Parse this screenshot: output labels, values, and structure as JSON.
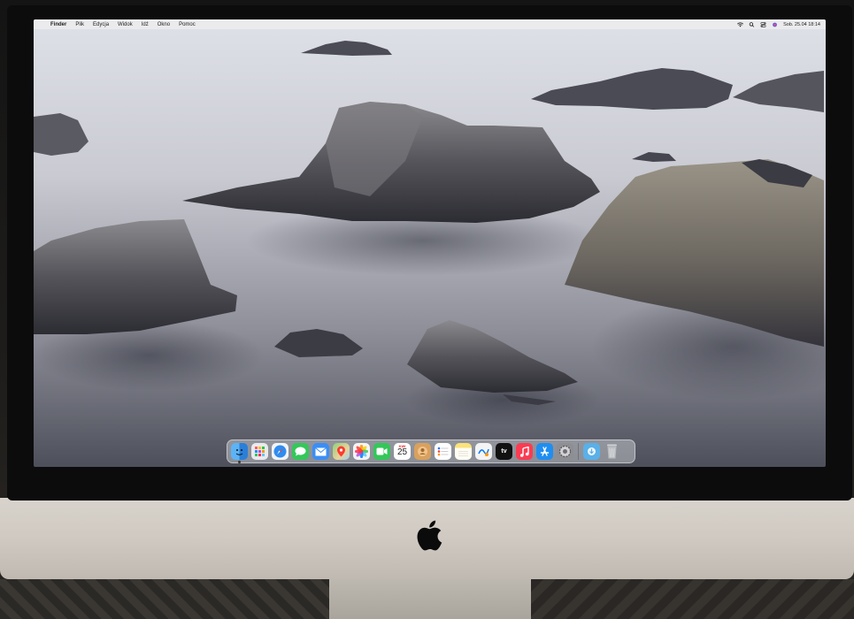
{
  "menubar": {
    "app_name": "Finder",
    "menus": [
      "Plik",
      "Edycja",
      "Widok",
      "Idź",
      "Okno",
      "Pomoc"
    ],
    "clock": "Sob. 25.04 18:14"
  },
  "dock": {
    "items": [
      {
        "name": "Finder",
        "icon": "finder-icon",
        "color": "#3c9cf0"
      },
      {
        "name": "Launchpad",
        "icon": "launchpad-icon",
        "color": "#e9e9ee"
      },
      {
        "name": "Safari",
        "icon": "safari-icon",
        "color": "#2f8cf0"
      },
      {
        "name": "Messages",
        "icon": "messages-icon",
        "color": "#34c759"
      },
      {
        "name": "Mail",
        "icon": "mail-icon",
        "color": "#3a8ef5"
      },
      {
        "name": "Maps",
        "icon": "maps-icon",
        "color": "#7ac36a"
      },
      {
        "name": "Photos",
        "icon": "photos-icon",
        "color": "#f4f4f4"
      },
      {
        "name": "FaceTime",
        "icon": "facetime-icon",
        "color": "#33c759"
      },
      {
        "name": "Calendar",
        "icon": "calendar-icon",
        "color": "#ffffff"
      },
      {
        "name": "Contacts",
        "icon": "contacts-icon",
        "color": "#d9a15d"
      },
      {
        "name": "Reminders",
        "icon": "reminders-icon",
        "color": "#ffffff"
      },
      {
        "name": "Notes",
        "icon": "notes-icon",
        "color": "#fbe27a"
      },
      {
        "name": "Freeform",
        "icon": "freeform-icon",
        "color": "#f4f4f4"
      },
      {
        "name": "TV",
        "icon": "tv-icon",
        "color": "#111111"
      },
      {
        "name": "Music",
        "icon": "music-icon",
        "color": "#fa3c52"
      },
      {
        "name": "App Store",
        "icon": "app-store-icon",
        "color": "#1f8ef1"
      },
      {
        "name": "System Settings",
        "icon": "settings-icon",
        "color": "#8e8e93"
      },
      {
        "name": "Downloads",
        "icon": "downloads-folder-icon",
        "color": "#5ab0e8"
      },
      {
        "name": "Trash",
        "icon": "trash-icon",
        "color": "#b9bcc0"
      }
    ],
    "calendar": {
      "month": "KWI",
      "day": "25"
    },
    "tv_label": "tv"
  }
}
